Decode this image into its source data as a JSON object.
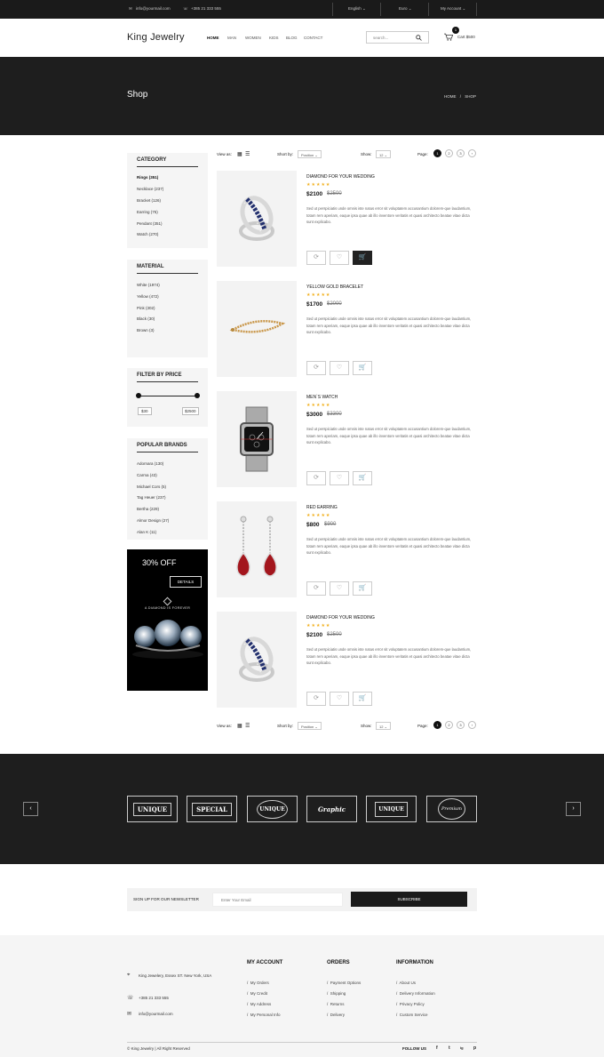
{
  "topbar": {
    "email": "info@yourmail.com",
    "phone": "+385 21 333 555",
    "language": "English",
    "currency": "Euro",
    "account": "My Account"
  },
  "header": {
    "logo": "King Jewelry",
    "nav": [
      "HOME",
      "MAN",
      "WOMEN",
      "KIDS",
      "BLOG",
      "CONTACT"
    ],
    "search_placeholder": "search...",
    "cart_count": "1",
    "cart_label": "Cart $500"
  },
  "banner": {
    "title": "Shop",
    "breadcrumb_home": "HOME",
    "breadcrumb_sep": "/",
    "breadcrumb_current": "SHOP"
  },
  "sidebar": {
    "category": {
      "title": "CATEGORY",
      "items": [
        "Rings (351)",
        "Necklace (237)",
        "Bracket (126)",
        "Earring (75)",
        "Pendant (351)",
        "Watch (270)"
      ]
    },
    "material": {
      "title": "MATERIAL",
      "items": [
        "White (1974)",
        "Yellow (472)",
        "Pink (302)",
        "Black (30)",
        "Brown (3)"
      ]
    },
    "price": {
      "title": "FILTER BY PRICE",
      "min": "$30",
      "max": "$2500"
    },
    "brands": {
      "title": "POPULAR BRANDS",
      "items": [
        "Adornara (130)",
        "Carma (43)",
        "Michael Cors (5)",
        "Tag Heuer (237)",
        "Bertha (229)",
        "Almor Design (27)",
        "Alan K (11)"
      ]
    },
    "promo": {
      "headline": "30% OFF",
      "button": "DETAILS",
      "tagline": "A DIAMOND IS FOREVER"
    }
  },
  "toolbar": {
    "view_label": "View as:",
    "sort_label": "Short by:",
    "sort_value": "Position",
    "show_label": "Show:",
    "show_value": "12",
    "page_label": "Page:",
    "pages": [
      "1",
      "2",
      "3"
    ],
    "next": "›"
  },
  "products": [
    {
      "name": "DIAMOND FOR YOUR WEDDING",
      "stars": "★★★★★",
      "price": "$2100",
      "old_price": "$2500",
      "description": "Sed ut perspiciatis unde omnis iste natus error sit voluptatem accusantium dolorem-que laudantium, totam rem aperiam, eaque ipsa quae ab illo inventore veritatis et quasi architecto beatae vitae dicta sunt explicabo."
    },
    {
      "name": "YELLOW GOLD BRACELET",
      "stars": "★★★★★",
      "price": "$1700",
      "old_price": "$2000",
      "description": "Sed ut perspiciatis unde omnis iste natus error sit voluptatem accusantium dolorem-que laudantium, totam rem aperiam, eaque ipsa quae ab illo inventore veritatis et quasi architecto beatae vitae dicta sunt explicabo."
    },
    {
      "name": "MEN`S WATCH",
      "stars": "★★★★★",
      "price": "$3000",
      "old_price": "$3300",
      "description": "Sed ut perspiciatis unde omnis iste natus error sit voluptatem accusantium dolorem-que laudantium, totam rem aperiam, eaque ipsa quae ab illo inventore veritatis et quasi architecto beatae vitae dicta sunt explicabo."
    },
    {
      "name": "RED EARRING",
      "stars": "★★★★★",
      "price": "$800",
      "old_price": "$900",
      "description": "Sed ut perspiciatis unde omnis iste natus error sit voluptatem accusantium dolorem-que laudantium, totam rem aperiam, eaque ipsa quae ab illo inventore veritatis et quasi architecto beatae vitae dicta sunt explicabo."
    },
    {
      "name": "DIAMOND FOR YOUR WEDDING",
      "stars": "★★★★★",
      "price": "$2100",
      "old_price": "$2500",
      "description": "Sed ut perspiciatis unde omnis iste natus error sit voluptatem accusantium dolorem-que laudantium, totam rem aperiam, eaque ipsa quae ab illo inventore veritatis et quasi architecto beatae vitae dicta sunt explicabo."
    }
  ],
  "brand_logos": [
    "UNIQUE",
    "SPECIAL",
    "UNIQUE",
    "Graphic",
    "UNIQUE",
    "Premium"
  ],
  "newsletter": {
    "label": "SIGN UP FOR OUR NEWSLETTER",
    "placeholder": "Enter Your Email",
    "button": "SUBSCRIBE"
  },
  "footer": {
    "address": "King Jewelery, Essex ST. New York, USA",
    "phone": "+385 21 333 555",
    "email": "info@yourmail.com",
    "columns": [
      {
        "title": "MY ACCOUNT",
        "links": [
          "My Orders",
          "My Credit",
          "My Address",
          "My Personal Info"
        ]
      },
      {
        "title": "ORDERS",
        "links": [
          "Payment Options",
          "Shipping",
          "Returns",
          "Delivery"
        ]
      },
      {
        "title": "INFORMATION",
        "links": [
          "About Us",
          "Delivery Information",
          "Privacy Policy",
          "Custom Service"
        ]
      }
    ],
    "copyright": "© King Jewelry | All Right Reserved",
    "follow": "FOLLOW US",
    "social": [
      "f",
      "t",
      "ig",
      "p"
    ]
  },
  "colors": {
    "dark": "#1e1e1e",
    "star": "#f2b01e",
    "accent": "#111111"
  }
}
